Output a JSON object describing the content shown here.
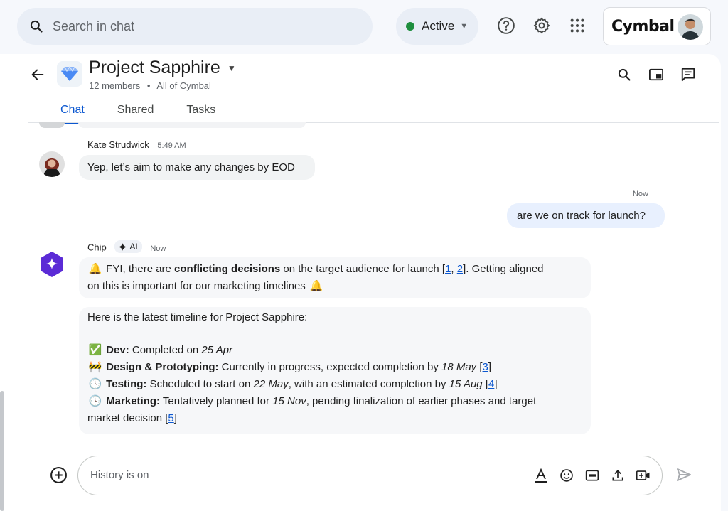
{
  "topbar": {
    "search_placeholder": "Search in chat",
    "status_label": "Active",
    "brand_logo": "Cymbal",
    "icons": [
      "search-icon",
      "help-icon",
      "gear-icon",
      "apps-grid-icon"
    ]
  },
  "space": {
    "title": "Project Sapphire",
    "members": "12 members",
    "separator": "•",
    "org": "All of Cymbal",
    "tabs": [
      "Chat",
      "Shared",
      "Tasks"
    ],
    "active_tab": "Chat"
  },
  "messages": {
    "kate": {
      "sender": "Kate Strudwick",
      "time": "5:49 AM",
      "text": "Yep, let’s aim to make any changes by EOD"
    },
    "user": {
      "time": "Now",
      "text": "are we on track for launch?"
    },
    "chip": {
      "sender": "Chip",
      "badge": "AI",
      "time": "Now",
      "alert_pre": "FYI, there are ",
      "alert_bold": "conflicting decisions",
      "alert_mid": " on the target audience for launch [",
      "ref1": "1",
      "ref_sep": ", ",
      "ref2": "2",
      "alert_post": "]. Getting aligned",
      "alert_line2": "on this is important for our marketing timelines",
      "timeline_intro": "Here is the latest timeline for Project Sapphire:",
      "timeline": {
        "dev_label": "Dev:",
        "dev_pre": " Completed on ",
        "dev_date": "25 Apr",
        "design_label": "Design & Prototyping:",
        "design_pre": " Currently in progress, expected completion by ",
        "design_date": "18 May",
        "design_ref": "3",
        "testing_label": "Testing:",
        "testing_pre": " Scheduled to start on ",
        "testing_date1": "22 May",
        "testing_mid": ", with an estimated completion by ",
        "testing_date2": "15 Aug",
        "testing_ref": "4",
        "marketing_label": "Marketing:",
        "marketing_pre": " Tentatively planned for ",
        "marketing_date": "15 Nov",
        "marketing_post": ", pending finalization of earlier phases and target",
        "marketing_line2": "market decision",
        "marketing_ref": "5"
      }
    }
  },
  "composer": {
    "placeholder": "History is on"
  },
  "colors": {
    "accent": "#0b57d0",
    "status_active": "#1e8e3e",
    "chip_purple": "#5b2bd6"
  }
}
